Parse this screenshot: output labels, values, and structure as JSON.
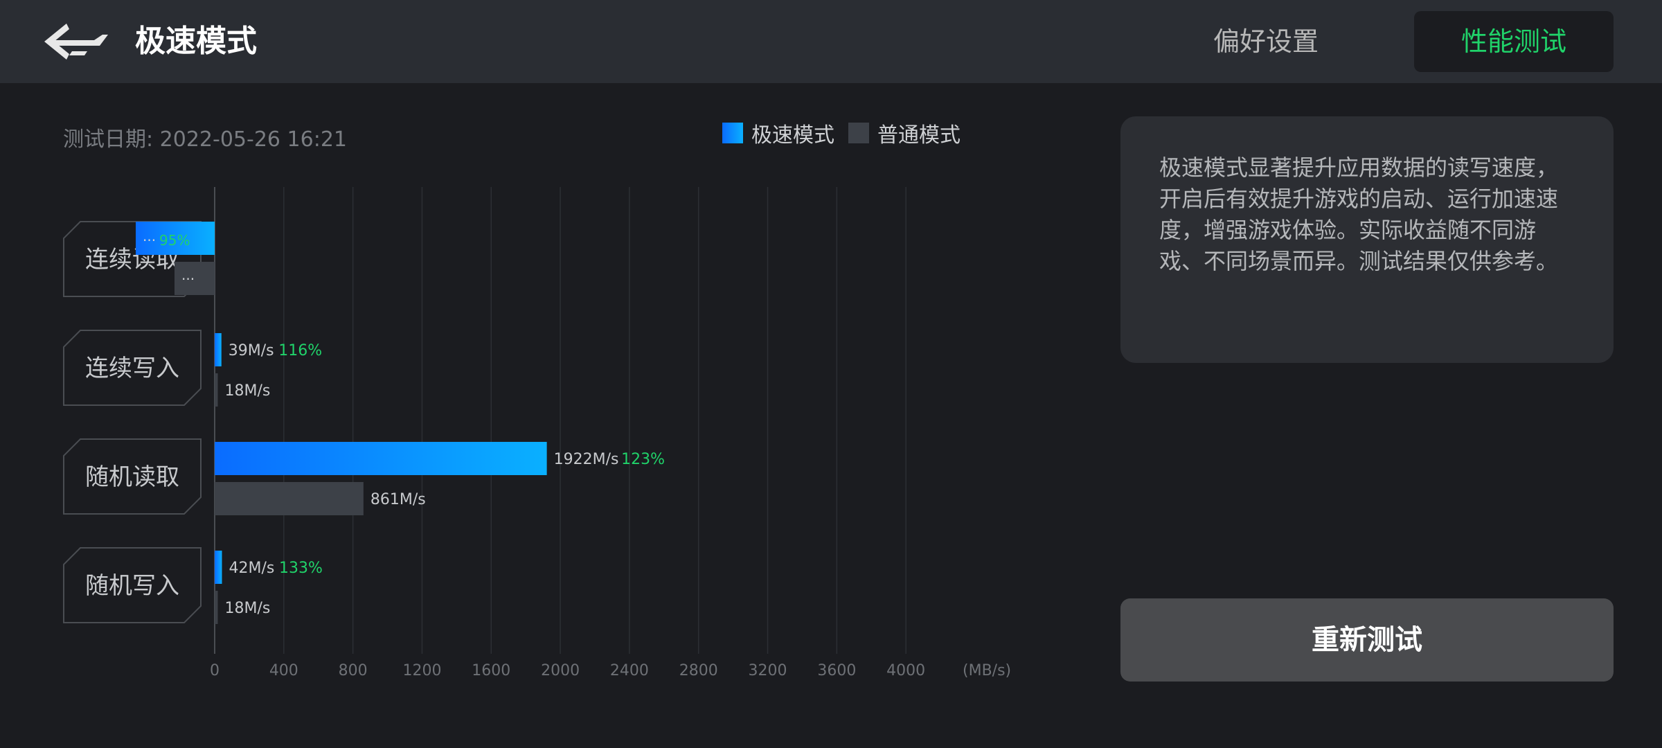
{
  "header": {
    "title": "极速模式",
    "tabs": [
      {
        "label": "偏好设置",
        "active": false
      },
      {
        "label": "性能测试",
        "active": true
      }
    ]
  },
  "test_date": {
    "label": "测试日期: ",
    "value": "2022-05-26 16:21"
  },
  "legend": {
    "fast": "极速模式",
    "normal": "普通模式"
  },
  "info_text": "极速模式显著提升应用数据的读写速度，开启后有效提升游戏的启动、运行加速速度，增强游戏体验。实际收益随不同游戏、不同场景而异。测试结果仅供参考。",
  "retest_label": "重新测试",
  "colors": {
    "accent_green": "#20d36a",
    "fast_bar_start": "#0a6cff",
    "fast_bar_end": "#0ab0ff",
    "normal_bar": "#3d4148"
  },
  "chart_data": {
    "type": "bar",
    "orientation": "horizontal",
    "xlim": [
      0,
      4400
    ],
    "x_ticks": [
      "0",
      "400",
      "800",
      "1200",
      "1600",
      "2000",
      "2400",
      "2800",
      "3200",
      "3600",
      "4000"
    ],
    "x_unit": "(MB/s)",
    "categories": [
      "连续读取",
      "连续写入",
      "随机读取",
      "随机写入"
    ],
    "series": [
      {
        "name": "极速模式",
        "values": [
          null,
          39,
          1922,
          42
        ],
        "labels": [
          "···",
          "39M/s",
          "1922M/s",
          "42M/s"
        ]
      },
      {
        "name": "普通模式",
        "values": [
          null,
          18,
          861,
          18
        ],
        "labels": [
          "···",
          "18M/s",
          "861M/s",
          "18M/s"
        ]
      }
    ],
    "improvements": [
      "95%",
      "116%",
      "123%",
      "133%"
    ]
  }
}
